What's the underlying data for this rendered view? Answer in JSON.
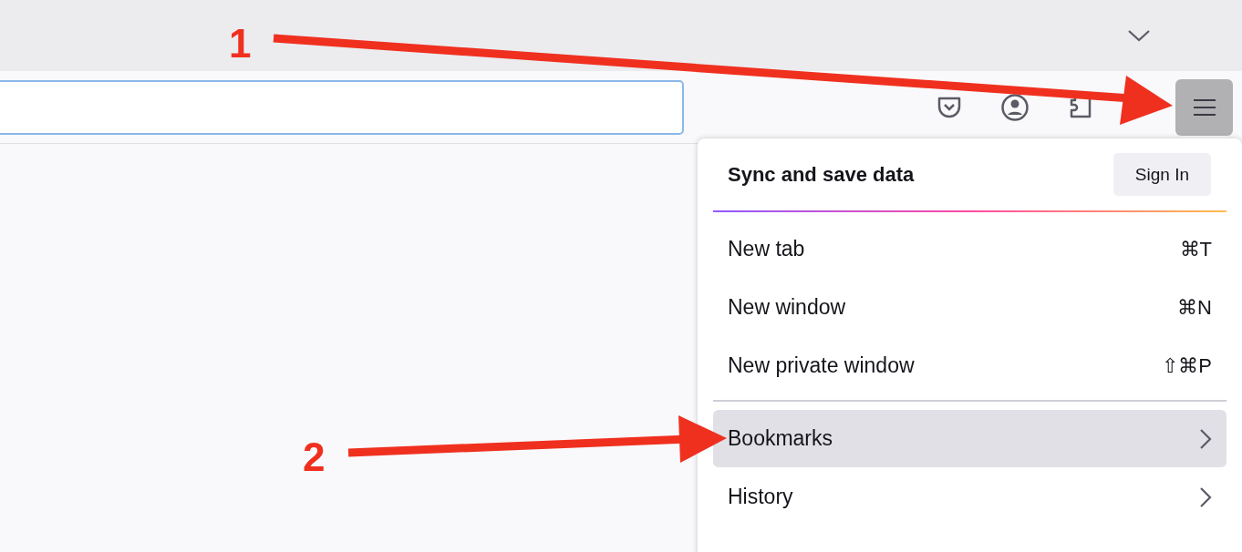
{
  "menu": {
    "title": "Sync and save data",
    "sign_in": "Sign In",
    "items": [
      {
        "kind": "item",
        "label": "New tab",
        "shortcut": "⌘T",
        "selected": false
      },
      {
        "kind": "item",
        "label": "New window",
        "shortcut": "⌘N",
        "selected": false
      },
      {
        "kind": "item",
        "label": "New private window",
        "shortcut": "⇧⌘P",
        "selected": false
      },
      {
        "kind": "separator"
      },
      {
        "kind": "submenu",
        "label": "Bookmarks",
        "selected": true
      },
      {
        "kind": "submenu",
        "label": "History",
        "selected": false
      }
    ]
  },
  "annotations": [
    {
      "label": "1"
    },
    {
      "label": "2"
    }
  ]
}
